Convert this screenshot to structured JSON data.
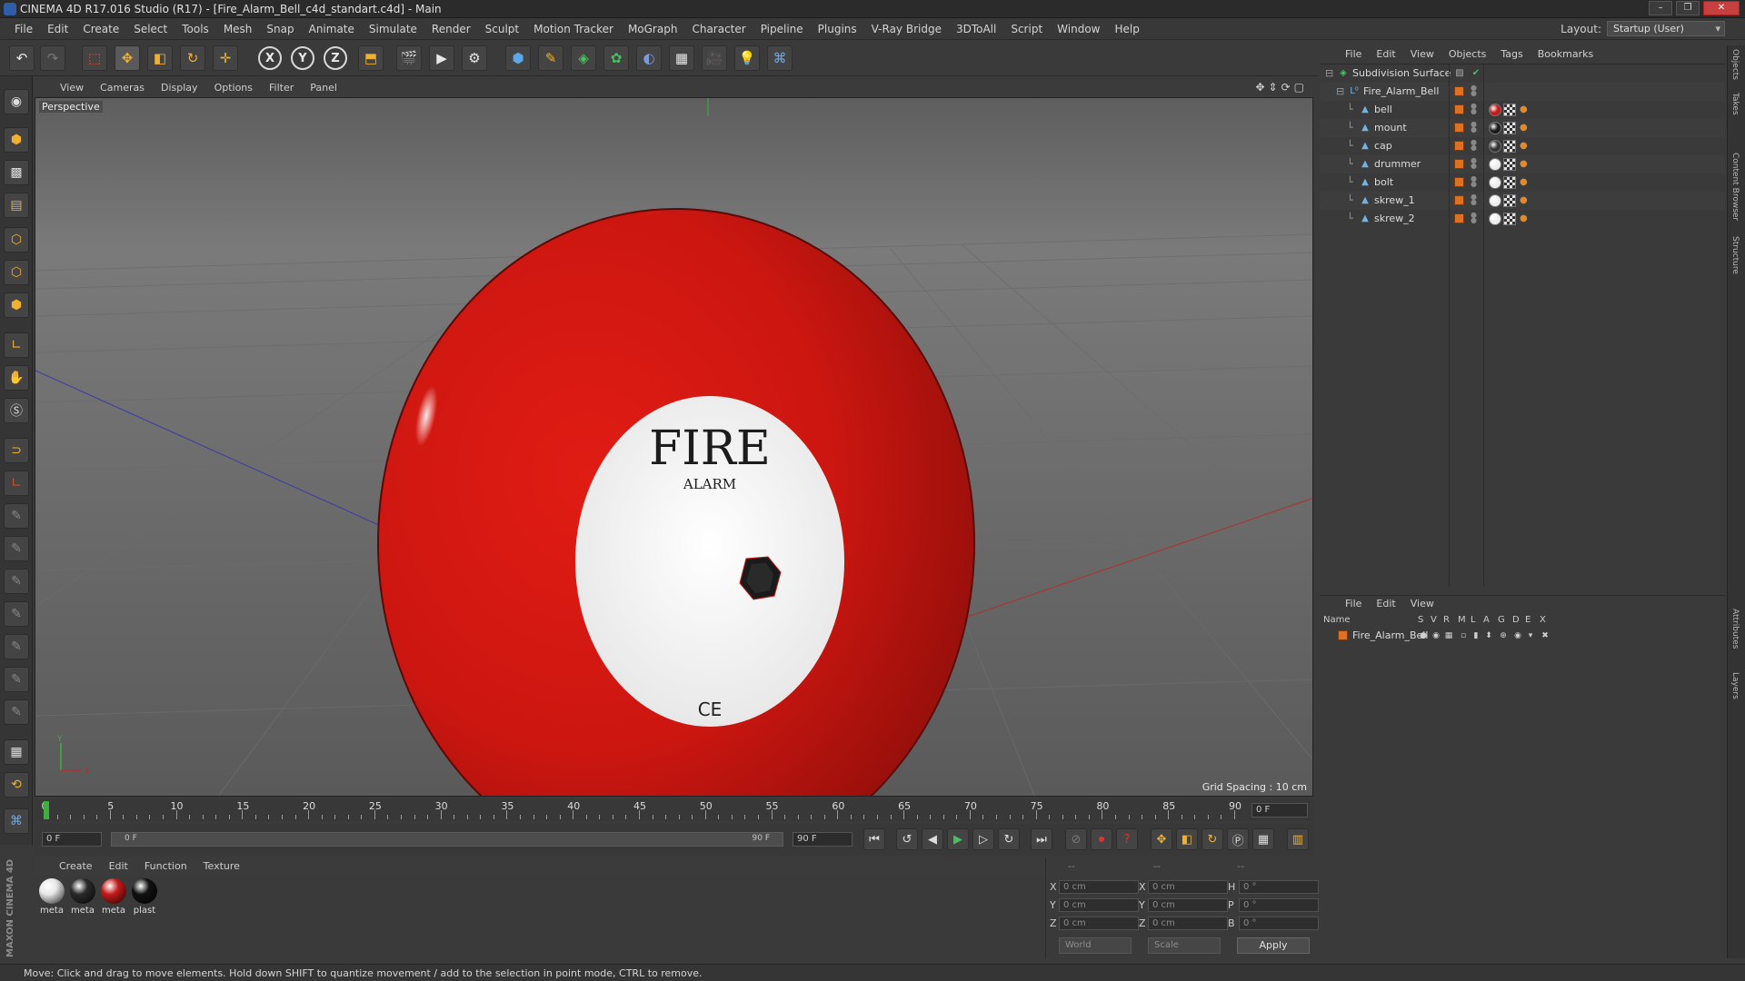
{
  "window": {
    "title": "CINEMA 4D R17.016 Studio (R17) - [Fire_Alarm_Bell_c4d_standart.c4d] - Main",
    "buttons": [
      "–",
      "❐",
      "✕"
    ]
  },
  "menubar": {
    "items": [
      "File",
      "Edit",
      "Create",
      "Select",
      "Tools",
      "Mesh",
      "Snap",
      "Animate",
      "Simulate",
      "Render",
      "Sculpt",
      "Motion Tracker",
      "MoGraph",
      "Character",
      "Pipeline",
      "Plugins",
      "V-Ray Bridge",
      "3DToAll",
      "Script",
      "Window",
      "Help"
    ],
    "layout_label": "Layout:",
    "layout_value": "Startup (User)"
  },
  "toolbar": {
    "icons": [
      "undo-icon",
      "redo-icon",
      "live-select-icon",
      "move-icon",
      "scale-icon",
      "rotate-icon",
      "recent-tool-icon",
      "x-axis-icon",
      "y-axis-icon",
      "z-axis-icon",
      "coordinate-system-icon",
      "render-view-icon",
      "render-picture-viewer-icon",
      "edit-render-settings-icon",
      "cube-icon",
      "pen-spline-icon",
      "subdivision-icon",
      "array-icon",
      "deformer-icon",
      "floor-icon",
      "camera-icon",
      "light-icon",
      "python-icon"
    ],
    "axis_labels": [
      "X",
      "Y",
      "Z"
    ]
  },
  "viewport": {
    "menu": [
      "View",
      "Cameras",
      "Display",
      "Options",
      "Filter",
      "Panel"
    ],
    "label": "Perspective",
    "grid_spacing": "Grid Spacing : 10 cm",
    "object_text_main": "FIRE",
    "object_text_sub": "ALARM",
    "object_mark": "CE",
    "axis_labels": [
      "Y",
      "X"
    ]
  },
  "timeline": {
    "ticks": [
      "0",
      "5",
      "10",
      "15",
      "20",
      "25",
      "30",
      "35",
      "40",
      "45",
      "50",
      "55",
      "60",
      "65",
      "70",
      "75",
      "80",
      "85",
      "90"
    ],
    "current_frame": "0 F"
  },
  "transport": {
    "start_field": "0 F",
    "range_left": "0 F",
    "range_right": "90 F",
    "end_field": "90 F"
  },
  "material_manager": {
    "menu": [
      "Create",
      "Edit",
      "Function",
      "Texture"
    ],
    "materials": [
      {
        "label": "meta",
        "color": "#e8e8e8"
      },
      {
        "label": "meta",
        "color": "#2a2a2a"
      },
      {
        "label": "meta",
        "color": "#c41a1a"
      },
      {
        "label": "plast",
        "color": "#111111"
      }
    ]
  },
  "coordinates": {
    "headers": [
      "--",
      "--",
      "--"
    ],
    "rows": [
      {
        "a": "X",
        "av": "0 cm",
        "b": "X",
        "bv": "0 cm",
        "c": "H",
        "cv": "0 °"
      },
      {
        "a": "Y",
        "av": "0 cm",
        "b": "Y",
        "bv": "0 cm",
        "c": "P",
        "cv": "0 °"
      },
      {
        "a": "Z",
        "av": "0 cm",
        "b": "Z",
        "bv": "0 cm",
        "c": "B",
        "cv": "0 °"
      }
    ],
    "mode1": "World",
    "mode2": "Scale",
    "apply": "Apply"
  },
  "object_manager": {
    "menu": [
      "File",
      "Edit",
      "View",
      "Objects",
      "Tags",
      "Bookmarks"
    ],
    "objects": [
      {
        "name": "Subdivision Surface",
        "level": 0
      },
      {
        "name": "Fire_Alarm_Bell",
        "level": 1
      },
      {
        "name": "bell",
        "level": 2
      },
      {
        "name": "mount",
        "level": 2
      },
      {
        "name": "cap",
        "level": 2
      },
      {
        "name": "drummer",
        "level": 2
      },
      {
        "name": "bolt",
        "level": 2
      },
      {
        "name": "skrew_1",
        "level": 2
      },
      {
        "name": "skrew_2",
        "level": 2
      }
    ]
  },
  "layer_manager": {
    "menu": [
      "File",
      "Edit",
      "View"
    ],
    "columns": [
      "Name",
      "S",
      "V",
      "R",
      "M",
      "L",
      "A",
      "G",
      "D",
      "E",
      "X"
    ],
    "layers": [
      "Fire_Alarm_Bell"
    ]
  },
  "side_tabs": [
    "Objects",
    "Takes",
    "Content Browser",
    "Structure",
    "Attributes",
    "Layers"
  ],
  "status": "Move: Click and drag to move elements. Hold down SHIFT to quantize movement / add to the selection in point mode, CTRL to remove.",
  "brand": "MAXON CINEMA 4D"
}
